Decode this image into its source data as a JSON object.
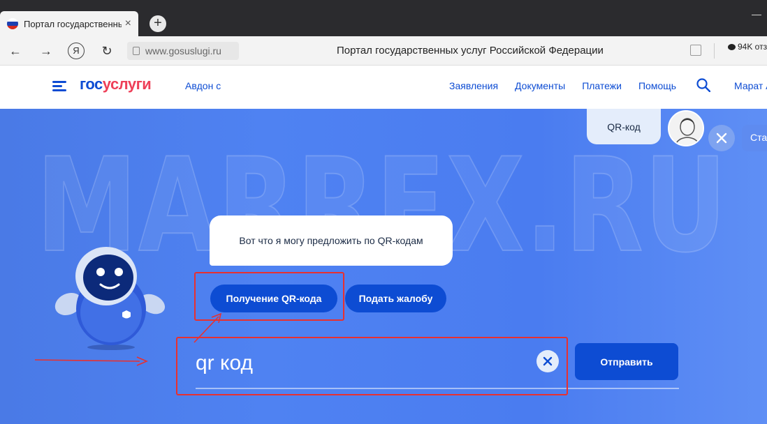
{
  "browser": {
    "tab_title": "Портал государственны",
    "tab_close": "×",
    "new_tab": "+",
    "win_minimize": "—",
    "back": "←",
    "forward": "→",
    "yandex": "Я",
    "reload": "↻",
    "url": "www.gosuslugi.ru",
    "page_title": "Портал государственных услуг Российской Федерации",
    "reviews": "94K отз"
  },
  "header": {
    "logo_part1": "гос",
    "logo_part2": "услуги",
    "region": "Авдон с",
    "nav": [
      "Заявления",
      "Документы",
      "Платежи",
      "Помощь"
    ],
    "user": "Марат А"
  },
  "chat": {
    "watermark": "MARREX.RU",
    "user_message": "QR-код",
    "start_link": "Ста",
    "bot_message": "Вот что я могу предложить по QR-кодам",
    "quick_replies": [
      "Получение QR-кода",
      "Подать жалобу"
    ],
    "input_value": "qr код",
    "send_label": "Отправить"
  },
  "colors": {
    "brand_blue": "#0d4cd3",
    "brand_red": "#ee3f58",
    "hero_blue": "#4f82f2",
    "annotation_red": "#e8302f"
  }
}
